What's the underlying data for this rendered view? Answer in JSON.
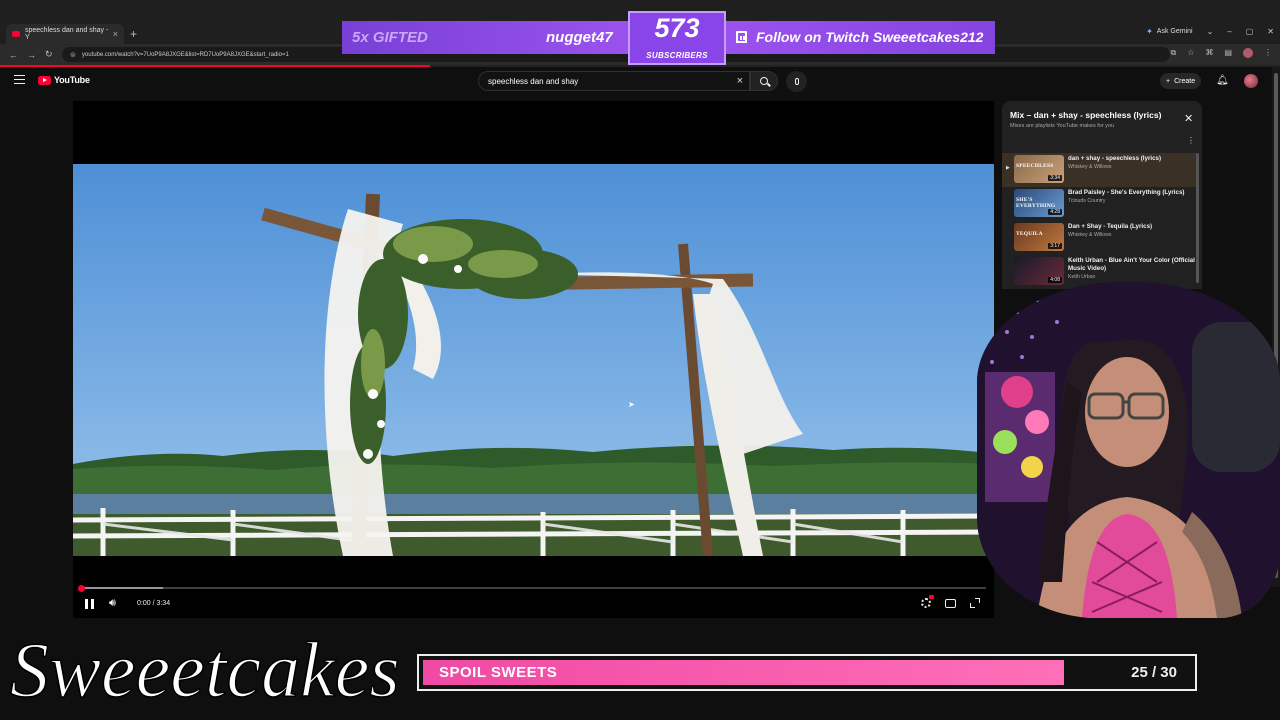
{
  "browser": {
    "tab_title": "speechless dan and shay - Y",
    "url": "youtube.com/watch?v=7UoP9A8JXGE&list=RD7UoP9A8JXGE&start_radio=1",
    "ask_gemini": "Ask Gemini"
  },
  "youtube": {
    "logo_text": "YouTube",
    "search_value": "speechless dan and shay",
    "create_label": "Create"
  },
  "player": {
    "time_display": "0:00 / 3:34",
    "played_fraction": 0.0
  },
  "playlist": {
    "title": "Mix – dan + shay - speechless (lyrics)",
    "subtitle": "Mixes are playlists YouTube makes for you",
    "items": [
      {
        "title": "dan + shay - speechless (lyrics)",
        "channel": "Whiskey & Willows",
        "duration": "3:34",
        "thumb_text": "SPEECHLESS",
        "current": true
      },
      {
        "title": "Brad Paisley - She's Everything (Lyrics)",
        "channel": "7clouds Country",
        "duration": "4:28",
        "thumb_text": "SHE'S EVERYTHING",
        "current": false
      },
      {
        "title": "Dan + Shay - Tequila (Lyrics)",
        "channel": "Whiskey & Willows",
        "duration": "3:17",
        "thumb_text": "TEQUILA",
        "current": false
      },
      {
        "title": "Keith Urban - Blue Ain't Your Color (Official Music Video)",
        "channel": "Keith Urban",
        "duration": "4:08",
        "thumb_text": "",
        "current": false
      }
    ]
  },
  "overlay": {
    "gifted_text": "5x GIFTED",
    "gifter_name": "nugget47",
    "sub_count": "573",
    "sub_label": "SUBSCRIBERS",
    "follow_text": "Follow on Twitch Sweeetcakes212",
    "brand_text": "Sweeetcakes",
    "goal_label": "SPOIL SWEETS",
    "goal_count": "25 / 30",
    "goal_fraction": 0.833
  },
  "colors": {
    "youtube_red": "#ff0033",
    "overlay_purple": "#8a45e8",
    "goal_pink": "#f04aa3"
  }
}
